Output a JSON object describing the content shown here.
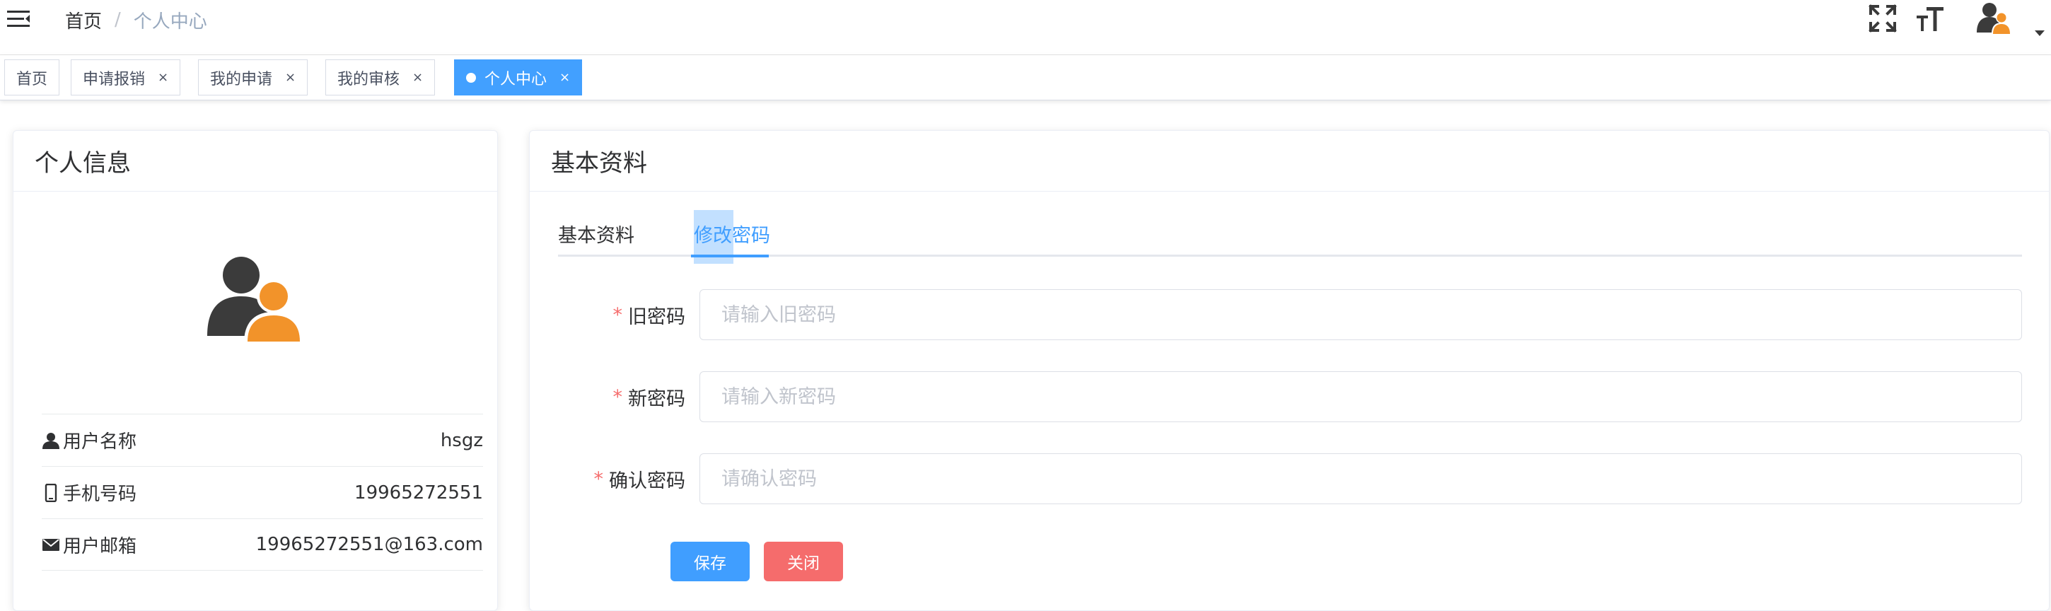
{
  "breadcrumb": {
    "home": "首页",
    "separator": "/",
    "current": "个人中心"
  },
  "navbar_icons": [
    "hamburger-icon",
    "fullscreen-icon",
    "font-size-icon",
    "avatar-icon",
    "caret-down-icon"
  ],
  "tags": [
    {
      "label": "首页",
      "closable": false,
      "active": false
    },
    {
      "label": "申请报销",
      "closable": true,
      "active": false
    },
    {
      "label": "我的申请",
      "closable": true,
      "active": false
    },
    {
      "label": "我的审核",
      "closable": true,
      "active": false
    },
    {
      "label": "个人中心",
      "closable": true,
      "active": true
    }
  ],
  "tag_close_glyph": "×",
  "left_card": {
    "title": "个人信息",
    "items": [
      {
        "label": "用户名称",
        "value": "hsgz",
        "icon": "user-icon"
      },
      {
        "label": "手机号码",
        "value": "19965272551",
        "icon": "phone-icon"
      },
      {
        "label": "用户邮箱",
        "value": "19965272551@163.com",
        "icon": "mail-icon"
      }
    ]
  },
  "right_card": {
    "title": "基本资料",
    "tabs": [
      {
        "label": "基本资料",
        "active": false
      },
      {
        "label": "修改密码",
        "active": true
      }
    ],
    "form": {
      "required_mark": "*",
      "fields": [
        {
          "label": "旧密码",
          "placeholder": "请输入旧密码",
          "value": ""
        },
        {
          "label": "新密码",
          "placeholder": "请输入新密码",
          "value": ""
        },
        {
          "label": "确认密码",
          "placeholder": "请确认密码",
          "value": ""
        }
      ],
      "save_label": "保存",
      "close_label": "关闭"
    }
  },
  "colors": {
    "primary": "#409eff",
    "active_tag": "#42a0ff",
    "danger": "#f56c6c",
    "required": "#f56c6c",
    "avatar_dark": "#3b3b3b",
    "avatar_orange": "#f2932a"
  }
}
